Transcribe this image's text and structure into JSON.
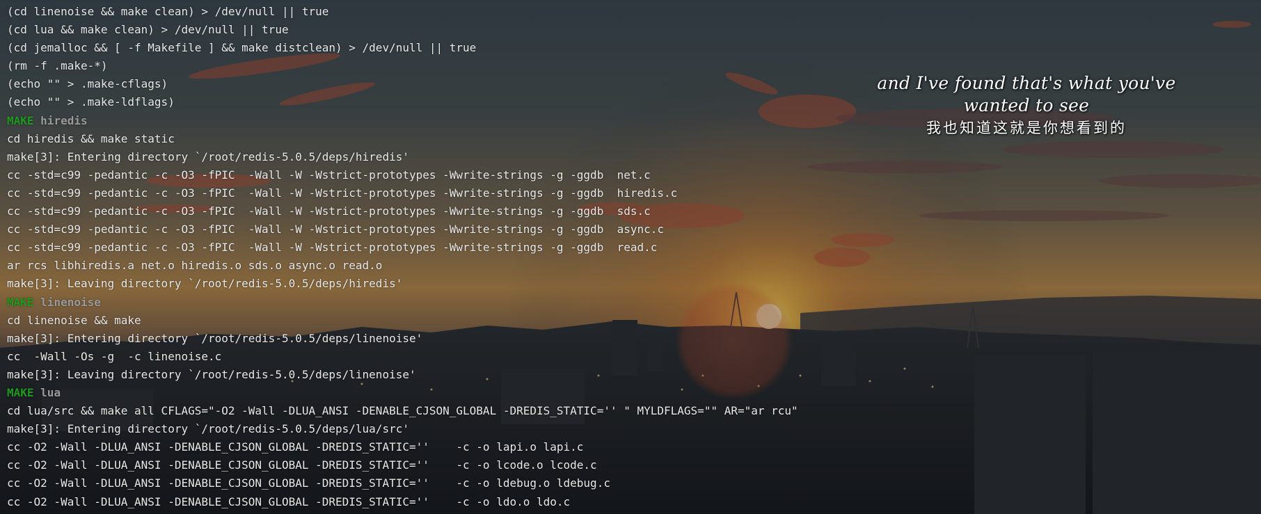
{
  "terminal": {
    "lines": [
      {
        "text": "(cd linenoise && make clean) > /dev/null || true"
      },
      {
        "text": "(cd lua && make clean) > /dev/null || true"
      },
      {
        "text": "(cd jemalloc && [ -f Makefile ] && make distclean) > /dev/null || true"
      },
      {
        "text": "(rm -f .make-*)"
      },
      {
        "text": "(echo \"\" > .make-cflags)"
      },
      {
        "text": "(echo \"\" > .make-ldflags)"
      },
      {
        "tag": "MAKE",
        "target": "hiredis"
      },
      {
        "text": "cd hiredis && make static"
      },
      {
        "text": "make[3]: Entering directory `/root/redis-5.0.5/deps/hiredis'"
      },
      {
        "text": "cc -std=c99 -pedantic -c -O3 -fPIC  -Wall -W -Wstrict-prototypes -Wwrite-strings -g -ggdb  net.c"
      },
      {
        "text": "cc -std=c99 -pedantic -c -O3 -fPIC  -Wall -W -Wstrict-prototypes -Wwrite-strings -g -ggdb  hiredis.c"
      },
      {
        "text": "cc -std=c99 -pedantic -c -O3 -fPIC  -Wall -W -Wstrict-prototypes -Wwrite-strings -g -ggdb  sds.c"
      },
      {
        "text": "cc -std=c99 -pedantic -c -O3 -fPIC  -Wall -W -Wstrict-prototypes -Wwrite-strings -g -ggdb  async.c"
      },
      {
        "text": "cc -std=c99 -pedantic -c -O3 -fPIC  -Wall -W -Wstrict-prototypes -Wwrite-strings -g -ggdb  read.c"
      },
      {
        "text": "ar rcs libhiredis.a net.o hiredis.o sds.o async.o read.o"
      },
      {
        "text": "make[3]: Leaving directory `/root/redis-5.0.5/deps/hiredis'"
      },
      {
        "tag": "MAKE",
        "target": "linenoise"
      },
      {
        "text": "cd linenoise && make"
      },
      {
        "text": "make[3]: Entering directory `/root/redis-5.0.5/deps/linenoise'"
      },
      {
        "text": "cc  -Wall -Os -g  -c linenoise.c"
      },
      {
        "text": "make[3]: Leaving directory `/root/redis-5.0.5/deps/linenoise'"
      },
      {
        "tag": "MAKE",
        "target": "lua"
      },
      {
        "text": "cd lua/src && make all CFLAGS=\"-O2 -Wall -DLUA_ANSI -DENABLE_CJSON_GLOBAL -DREDIS_STATIC='' \" MYLDFLAGS=\"\" AR=\"ar rcu\""
      },
      {
        "text": "make[3]: Entering directory `/root/redis-5.0.5/deps/lua/src'"
      },
      {
        "text": "cc -O2 -Wall -DLUA_ANSI -DENABLE_CJSON_GLOBAL -DREDIS_STATIC=''    -c -o lapi.o lapi.c"
      },
      {
        "text": "cc -O2 -Wall -DLUA_ANSI -DENABLE_CJSON_GLOBAL -DREDIS_STATIC=''    -c -o lcode.o lcode.c"
      },
      {
        "text": "cc -O2 -Wall -DLUA_ANSI -DENABLE_CJSON_GLOBAL -DREDIS_STATIC=''    -c -o ldebug.o ldebug.c"
      },
      {
        "text": "cc -O2 -Wall -DLUA_ANSI -DENABLE_CJSON_GLOBAL -DREDIS_STATIC=''    -c -o ldo.o ldo.c"
      }
    ]
  },
  "lyrics": {
    "english": "and I've found that's what you've wanted to see",
    "chinese": "我也知道这就是你想看到的"
  },
  "colors": {
    "make_tag": "#1e9a1e",
    "make_target": "#9a9a9a",
    "text": "#e8e8e8",
    "sky_top": "#3d4a52",
    "sunset": "#e59a3a"
  }
}
